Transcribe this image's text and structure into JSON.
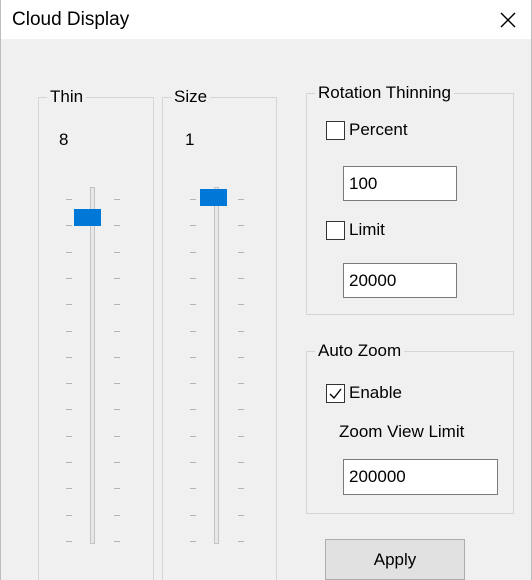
{
  "window": {
    "title": "Cloud Display",
    "close_icon": "close-icon"
  },
  "thin": {
    "label": "Thin",
    "value": "8",
    "slider_fraction": 0.06
  },
  "size": {
    "label": "Size",
    "value": "1",
    "slider_fraction": 0.0
  },
  "rotation_thinning": {
    "label": "Rotation Thinning",
    "percent": {
      "label": "Percent",
      "checked": false,
      "value": "100"
    },
    "limit": {
      "label": "Limit",
      "checked": false,
      "value": "20000"
    }
  },
  "auto_zoom": {
    "label": "Auto Zoom",
    "enable": {
      "label": "Enable",
      "checked": true
    },
    "zoom_view_limit_label": "Zoom View Limit",
    "zoom_view_limit_value": "200000"
  },
  "apply_button": {
    "label": "Apply"
  },
  "colors": {
    "accent": "#0078d7",
    "window_bg": "#f0f0f0"
  }
}
